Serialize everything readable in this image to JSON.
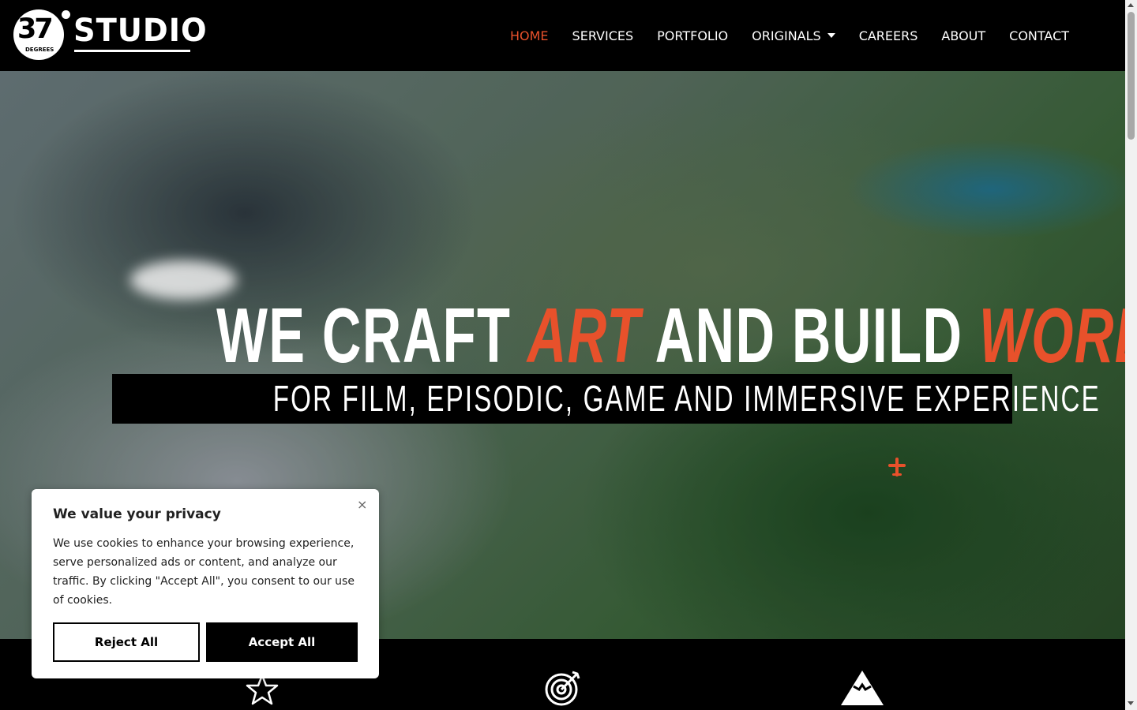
{
  "brand": {
    "logo_number": "37",
    "logo_sub": "DEGREES",
    "logo_word": "STUDIO"
  },
  "nav": {
    "items": [
      {
        "label": "HOME",
        "active": true
      },
      {
        "label": "SERVICES"
      },
      {
        "label": "PORTFOLIO"
      },
      {
        "label": "ORIGINALS",
        "dropdown": true
      },
      {
        "label": "CAREERS"
      },
      {
        "label": "ABOUT"
      },
      {
        "label": "CONTACT"
      }
    ]
  },
  "hero": {
    "headline_part1": "WE CRAFT ",
    "headline_accent1": "ART",
    "headline_part2": " AND BUILD ",
    "headline_accent2": "WORLDS",
    "subheadline": "FOR FILM, EPISODIC, GAME AND IMMERSIVE EXPERIENCE"
  },
  "features": {
    "icons": [
      "star-icon",
      "target-icon",
      "mountain-icon"
    ]
  },
  "cookie": {
    "title": "We value your privacy",
    "text": "We use cookies to enhance your browsing experience, serve personalized ads or content, and analyze our traffic. By clicking \"Accept All\", you consent to our use of cookies.",
    "reject_label": "Reject All",
    "accept_label": "Accept All",
    "close_glyph": "×"
  },
  "colors": {
    "accent": "#e8512b",
    "background": "#000000",
    "card": "#ffffff"
  }
}
